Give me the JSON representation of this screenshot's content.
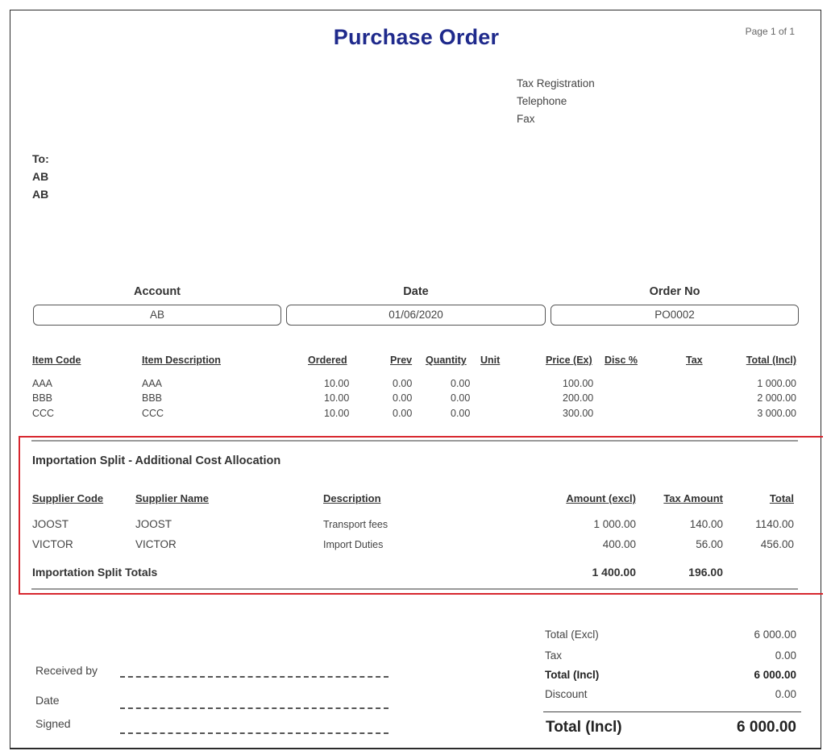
{
  "header": {
    "title": "Purchase Order",
    "page": "Page 1 of 1",
    "company_lines": [
      "Tax Registration",
      "Telephone",
      "Fax"
    ]
  },
  "to": {
    "label": "To:",
    "lines": [
      "AB",
      "AB"
    ]
  },
  "order_fields": [
    {
      "label": "Account",
      "value": "AB"
    },
    {
      "label": "Date",
      "value": "01/06/2020"
    },
    {
      "label": "Order No",
      "value": "PO0002"
    }
  ],
  "items": {
    "columns": {
      "item_code": "Item Code",
      "item_description": "Item Description",
      "ordered": "Ordered",
      "prev": "Prev",
      "quantity": "Quantity",
      "unit": "Unit",
      "price": "Price (Ex)",
      "disc": "Disc %",
      "tax": "Tax",
      "total": "Total (Incl)"
    },
    "rows": [
      {
        "code": "AAA",
        "description": "AAA",
        "ordered": "10.00",
        "prev": "0.00",
        "quantity": "0.00",
        "price": "100.00",
        "total": "1 000.00"
      },
      {
        "code": "BBB",
        "description": "BBB",
        "ordered": "10.00",
        "prev": "0.00",
        "quantity": "0.00",
        "price": "200.00",
        "total": "2 000.00"
      },
      {
        "code": "CCC",
        "description": "CCC",
        "ordered": "10.00",
        "prev": "0.00",
        "quantity": "0.00",
        "price": "300.00",
        "total": "3 000.00"
      }
    ]
  },
  "importation_split": {
    "title": "Importation Split - Additional Cost Allocation",
    "columns": {
      "supplier_code": "Supplier Code",
      "supplier_name": "Supplier Name",
      "description": "Description",
      "amount_excl": "Amount (excl)",
      "tax_amount": "Tax Amount",
      "total": "Total"
    },
    "rows": [
      {
        "supplier_code": "JOOST",
        "supplier_name": "JOOST",
        "description": "Transport fees",
        "amount_excl": "1 000.00",
        "tax_amount": "140.00",
        "total": "1140.00"
      },
      {
        "supplier_code": "VICTOR",
        "supplier_name": "VICTOR",
        "description": "Import Duties",
        "amount_excl": "400.00",
        "tax_amount": "56.00",
        "total": "456.00"
      }
    ],
    "totals": {
      "label": "Importation Split Totals",
      "amount_excl": "1 400.00",
      "tax_amount": "196.00"
    }
  },
  "signatures": {
    "received_by": "Received by",
    "date": "Date",
    "signed": "Signed"
  },
  "totals": {
    "total_excl_label": "Total (Excl)",
    "total_excl": "6 000.00",
    "tax_label": "Tax",
    "tax": "0.00",
    "total_incl_label": "Total (Incl)",
    "total_incl": "6 000.00",
    "discount_label": "Discount",
    "discount": "0.00",
    "grand_label": "Total (Incl)",
    "grand_value": "6 000.00"
  }
}
